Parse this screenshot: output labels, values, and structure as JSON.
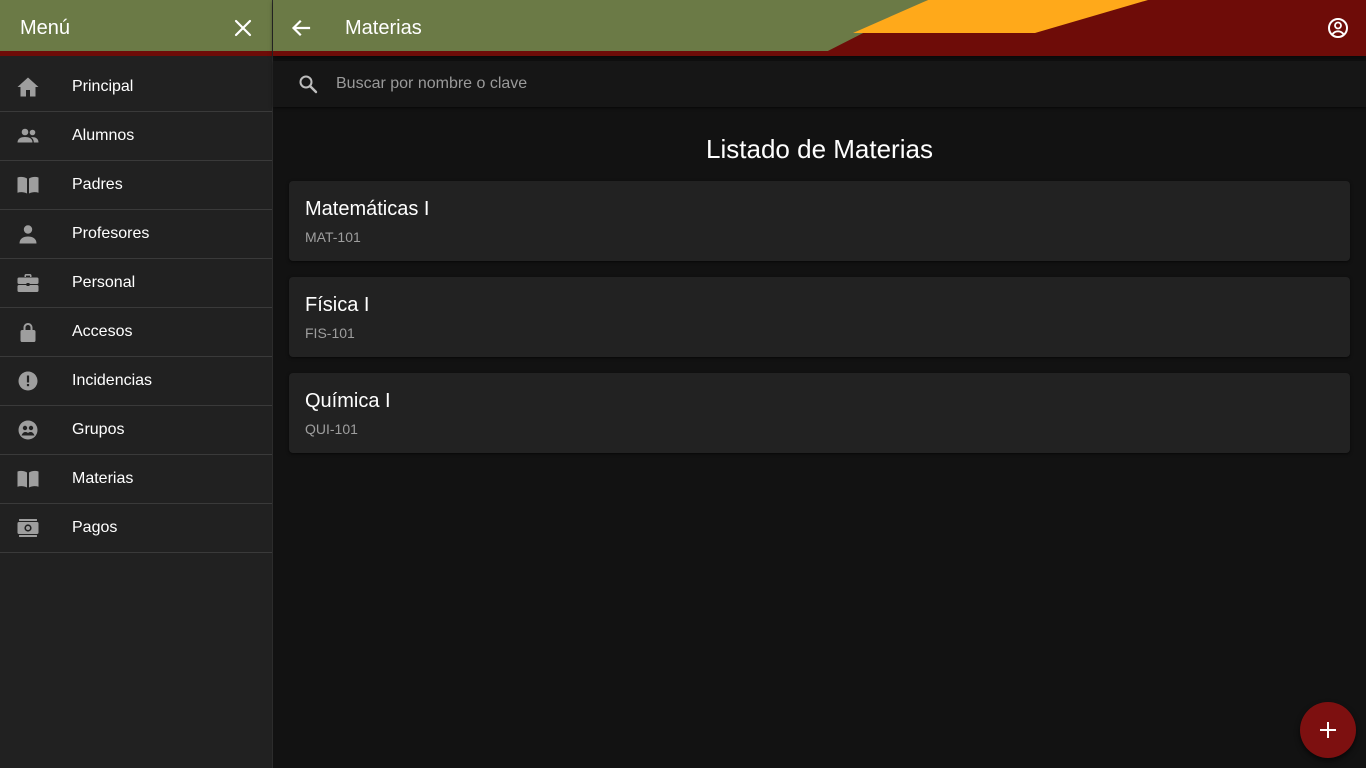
{
  "colors": {
    "header_green": "#6b7a46",
    "header_red": "#6e0c08",
    "header_orange": "#ffa91a",
    "fab": "#7d1010",
    "background": "#121212",
    "card": "#222222"
  },
  "sidebar": {
    "title": "Menú",
    "items": [
      {
        "label": "Principal",
        "icon": "home-icon"
      },
      {
        "label": "Alumnos",
        "icon": "people-icon"
      },
      {
        "label": "Padres",
        "icon": "book-open-icon"
      },
      {
        "label": "Profesores",
        "icon": "person-icon"
      },
      {
        "label": "Personal",
        "icon": "briefcase-icon"
      },
      {
        "label": "Accesos",
        "icon": "lock-icon"
      },
      {
        "label": "Incidencias",
        "icon": "alert-circle-icon"
      },
      {
        "label": "Grupos",
        "icon": "group-face-icon"
      },
      {
        "label": "Materias",
        "icon": "book-open-icon"
      },
      {
        "label": "Pagos",
        "icon": "payments-icon"
      }
    ]
  },
  "header": {
    "title": "Materias"
  },
  "search": {
    "placeholder": "Buscar por nombre o clave"
  },
  "main": {
    "list_title": "Listado de Materias",
    "subjects": [
      {
        "name": "Matemáticas I",
        "code": "MAT-101"
      },
      {
        "name": "Física I",
        "code": "FIS-101"
      },
      {
        "name": "Química I",
        "code": "QUI-101"
      }
    ]
  }
}
